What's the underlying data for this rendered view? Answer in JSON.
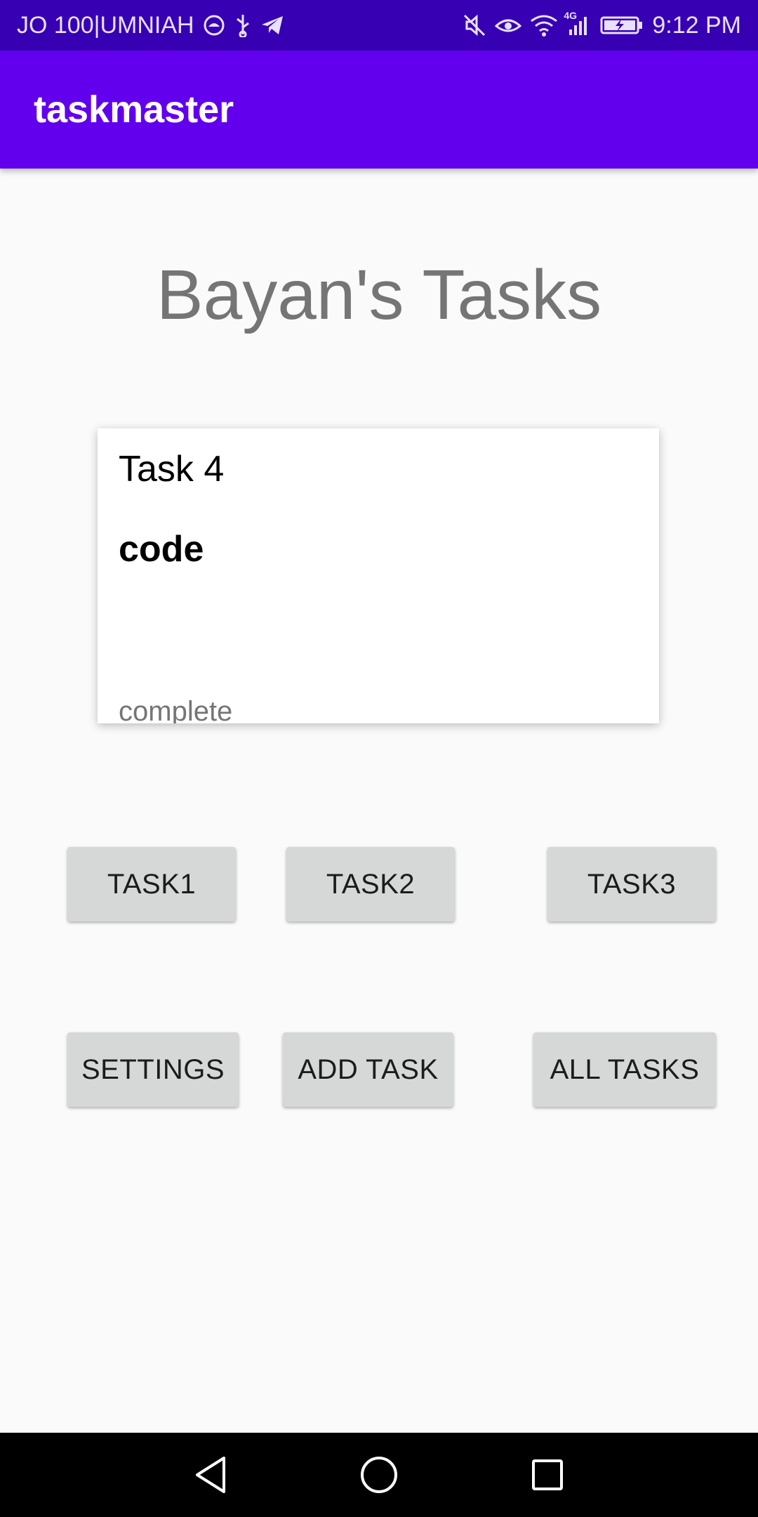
{
  "status_bar": {
    "carrier": "JO 100|UMNIAH",
    "network_label": "4G",
    "time": "9:12 PM"
  },
  "app_bar": {
    "title": "taskmaster"
  },
  "heading": "Bayan's Tasks",
  "task_card": {
    "title": "Task 4",
    "body": "code",
    "state": "complete"
  },
  "buttons": {
    "task1": "TASK1",
    "task2": "TASK2",
    "task3": "TASK3",
    "settings": "SETTINGS",
    "add_task": "ADD TASK",
    "all_tasks": "ALL TASKS"
  },
  "colors": {
    "status_bar": "#3700b3",
    "app_bar": "#6200ee",
    "button_bg": "#d6d7d7",
    "heading_text": "#757575"
  },
  "icons": {
    "status_left": [
      "sync-icon",
      "usb-icon",
      "telegram-icon"
    ],
    "status_right": [
      "mute-icon",
      "eye-comfort-icon",
      "wifi-icon",
      "signal-icon",
      "battery-charging-icon"
    ],
    "nav": [
      "back-icon",
      "home-icon",
      "recents-icon"
    ]
  }
}
